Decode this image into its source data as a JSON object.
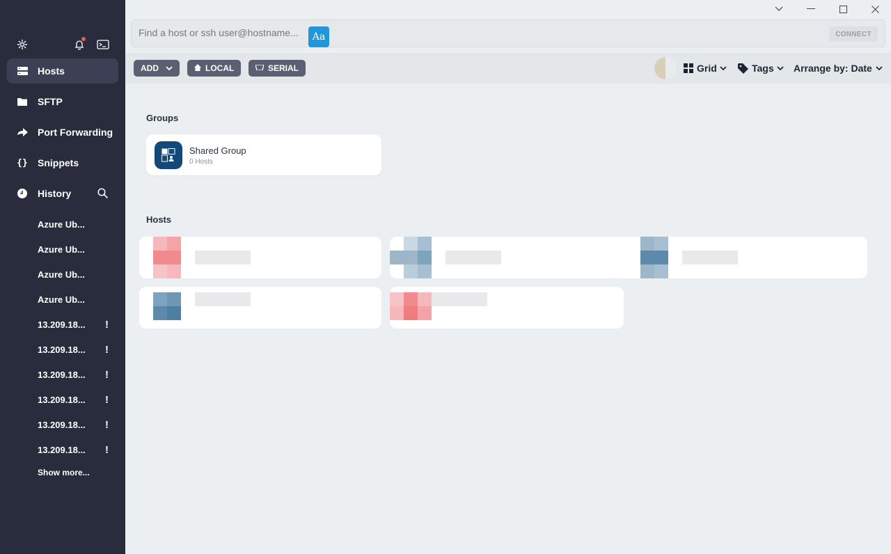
{
  "sidebar": {
    "nav": [
      {
        "label": "Hosts",
        "icon": "hosts-icon",
        "active": true
      },
      {
        "label": "SFTP",
        "icon": "folder-icon",
        "active": false
      },
      {
        "label": "Port Forwarding",
        "icon": "port-forwarding-icon",
        "active": false
      },
      {
        "label": "Snippets",
        "icon": "snippets-icon",
        "active": false
      },
      {
        "label": "History",
        "icon": "history-icon",
        "active": false
      }
    ],
    "history": [
      {
        "label": "Azure Ub...",
        "warning": ""
      },
      {
        "label": "Azure Ub...",
        "warning": ""
      },
      {
        "label": "Azure Ub...",
        "warning": ""
      },
      {
        "label": "Azure Ub...",
        "warning": ""
      },
      {
        "label": "13.209.18...",
        "warning": "!"
      },
      {
        "label": "13.209.18...",
        "warning": "!"
      },
      {
        "label": "13.209.18...",
        "warning": "!"
      },
      {
        "label": "13.209.18...",
        "warning": "!"
      },
      {
        "label": "13.209.18...",
        "warning": "!"
      },
      {
        "label": "13.209.18...",
        "warning": "!"
      }
    ],
    "show_more": "Show more..."
  },
  "search": {
    "placeholder": "Find a host or ssh user@hostname...",
    "badge": "Aa",
    "connect": "CONNECT"
  },
  "toolbar": {
    "add": "ADD",
    "local": "LOCAL",
    "serial": "SERIAL",
    "view": "Grid",
    "tags": "Tags",
    "arrange": "Arrange by: Date"
  },
  "content": {
    "groups_title": "Groups",
    "group": {
      "name": "Shared Group",
      "count": "0 Hosts"
    },
    "hosts_title": "Hosts"
  },
  "colors": {
    "sidebar_bg": "#282c3d",
    "accent": "#2196d9",
    "group_icon_bg": "#12497a"
  }
}
